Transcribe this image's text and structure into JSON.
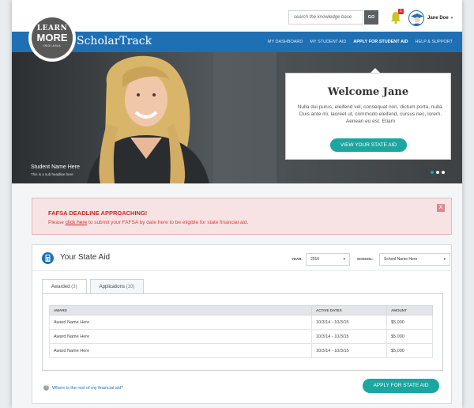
{
  "topbar": {
    "search_placeholder": "search the knowledge base",
    "go_label": "GO",
    "notification_count": "1",
    "user_name": "Jane Doe",
    "user_caret": "▾"
  },
  "brand": {
    "logo_line1": "LEARN",
    "logo_line2": "MORE",
    "logo_line3": "INDIANA",
    "name": "ScholarTrack"
  },
  "nav": {
    "items": [
      {
        "label": "MY DASHBOARD"
      },
      {
        "label": "MY STUDENT AID"
      },
      {
        "label": "APPLY FOR STUDENT AID"
      },
      {
        "label": "HELP & SUPPORT"
      }
    ]
  },
  "hero": {
    "student_name": "Student Name Here",
    "student_sub": "This is a sub headline here",
    "slide_count": 3,
    "active_slide": 1
  },
  "welcome": {
    "title": "Welcome Jane",
    "body": "Nulla dui purus, eleifend vel, consequat non, dictum porta, nulla. Duis ante mi, laoreet ut, commodo eleifend, cursus nec, lorem. Aenean eu est. Etiam",
    "button": "VIEW YOUR STATE AID"
  },
  "alert": {
    "title": "FAFSA DEADLINE APPROACHING!",
    "text_before": "Please ",
    "link": "click here",
    "text_after": " to submit your FAFSA by date here to be eligible for state financial aid.",
    "close": "X"
  },
  "state_aid": {
    "title": "Your State Aid",
    "year_label": "YEAR:",
    "year_value": "2016",
    "school_label": "SCHOOL:",
    "school_value": "School Name Here",
    "chevron": "▾",
    "tabs": [
      {
        "label": "Awarded",
        "count": "(3)"
      },
      {
        "label": "Applications",
        "count": "(10)"
      }
    ],
    "columns": [
      "AWARD",
      "ACTIVE DATES",
      "AMOUNT"
    ],
    "rows": [
      [
        "Award Name Here",
        "10/3/14 - 10/3/15",
        "$5,000"
      ],
      [
        "Award Name Here",
        "10/3/14 - 10/3/15",
        "$5,000"
      ],
      [
        "Award Name Here",
        "10/3/14 - 10/3/15",
        "$5,000"
      ]
    ],
    "help_icon": "?",
    "help_text": "Where is the rest of my financial aid?",
    "apply_button": "APPLY FOR STATE AID"
  },
  "colors": {
    "primary_blue": "#1e6fb3",
    "teal": "#1ba6a0",
    "alert_red": "#c62828"
  }
}
